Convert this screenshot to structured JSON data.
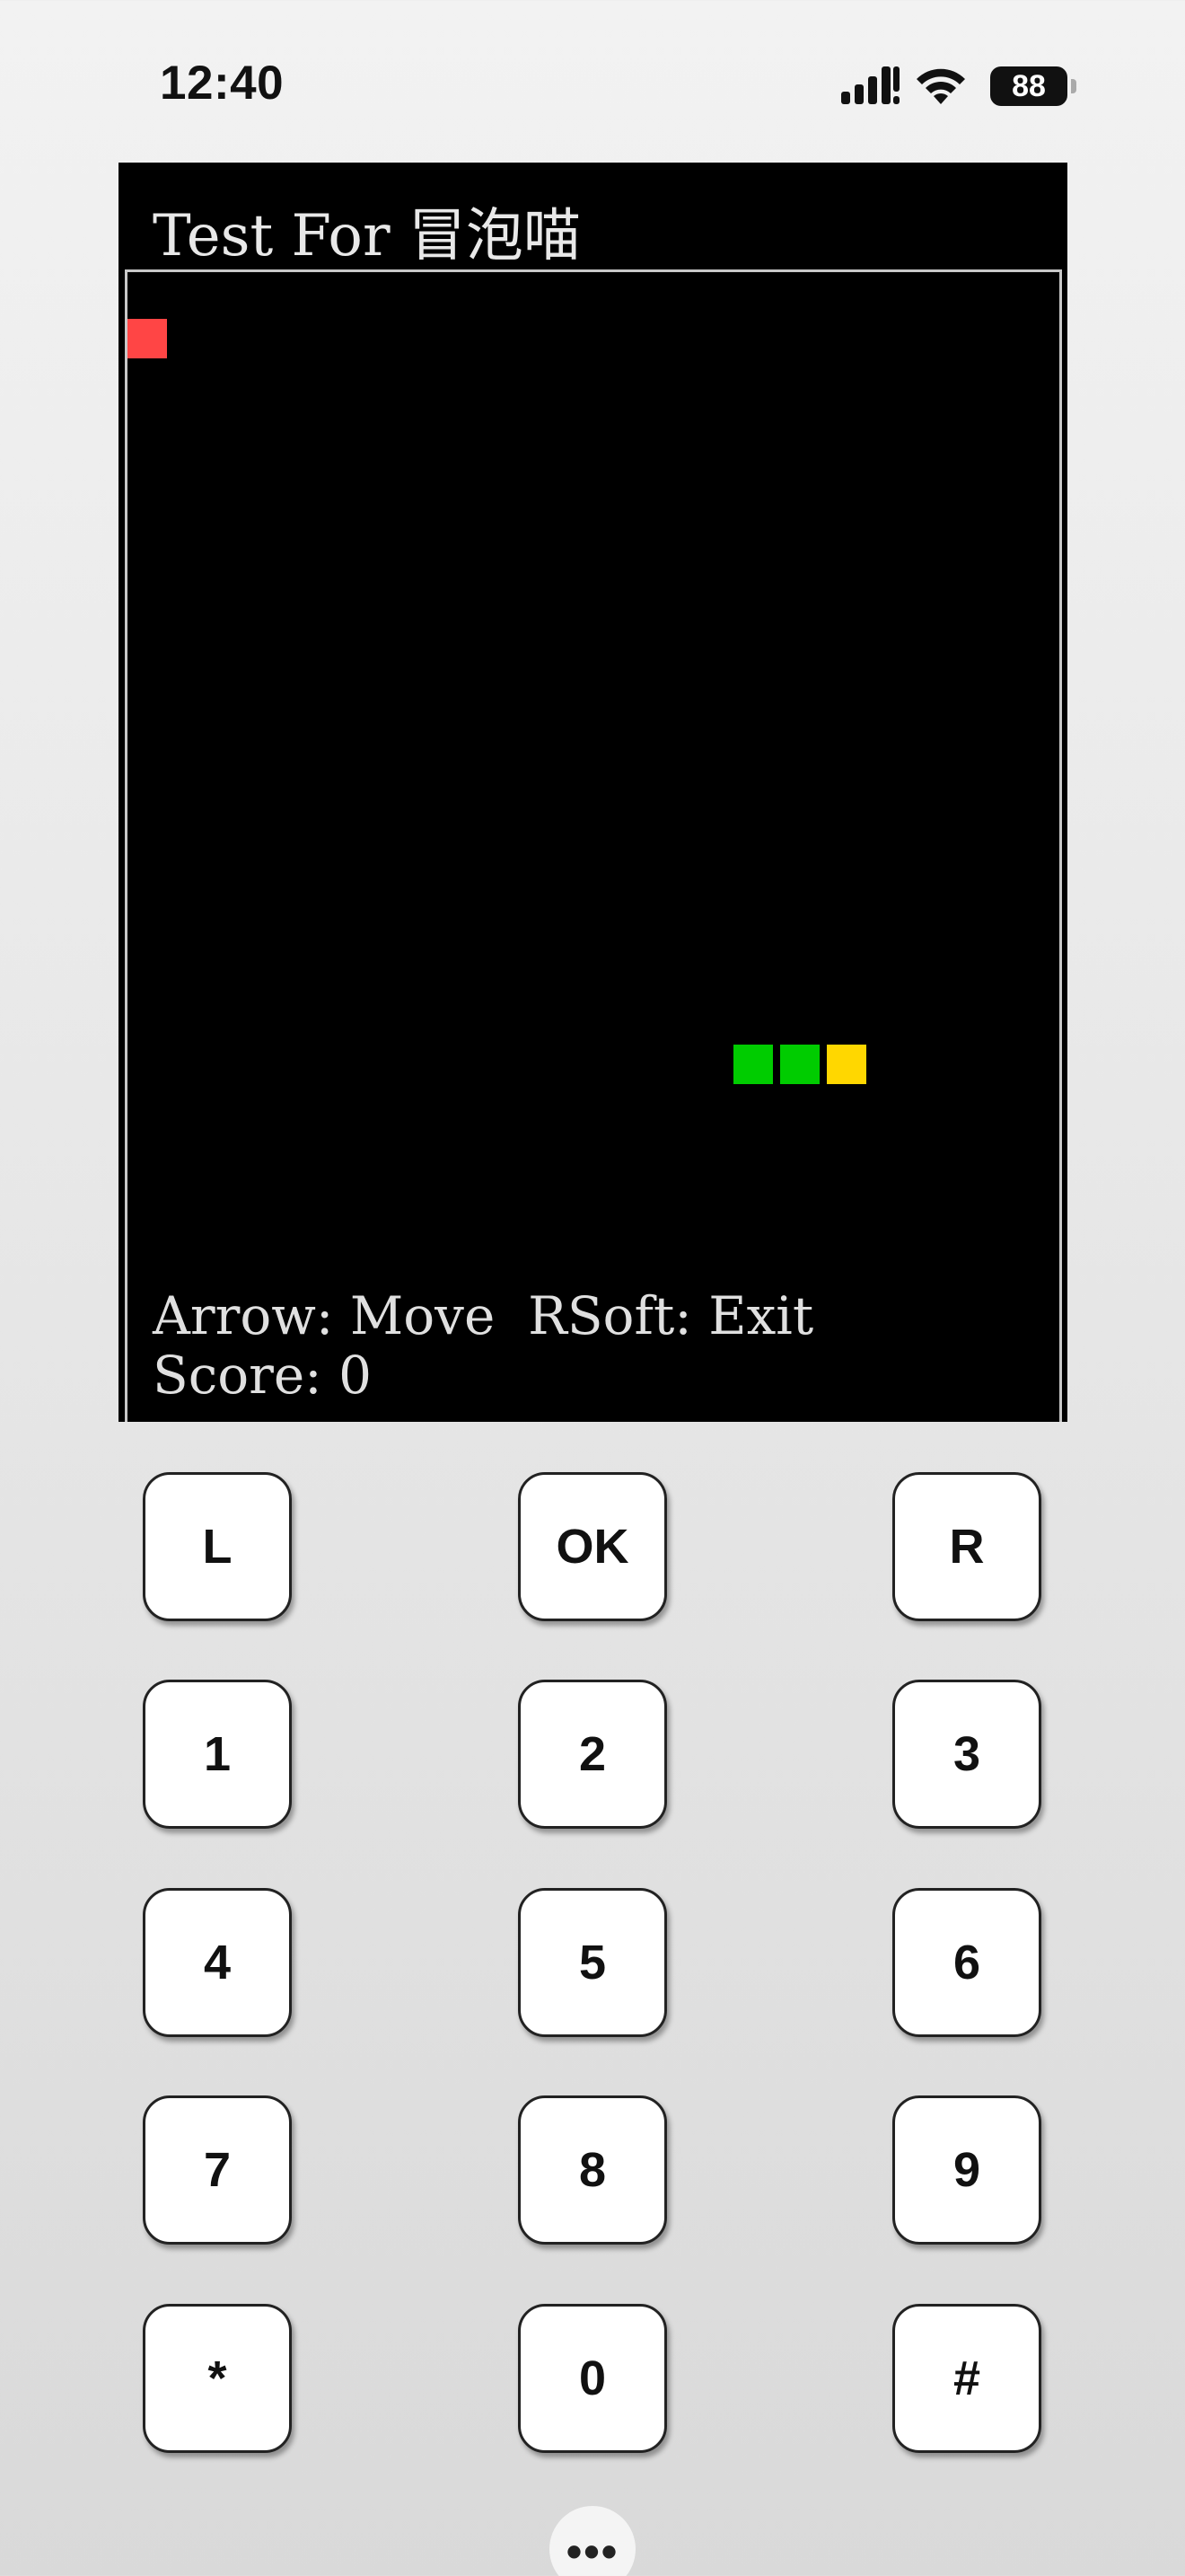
{
  "status_bar": {
    "time": "12:40",
    "battery": "88",
    "icons": [
      "cellular-signal-icon",
      "wifi-icon",
      "battery-icon"
    ]
  },
  "game": {
    "title": "Test For 冒泡喵",
    "help_text": "Arrow: Move  RSoft: Exit",
    "score_text": "Score: 0",
    "colors": {
      "background": "#000000",
      "food": "#ff4545",
      "snake_body": "#00cc00",
      "snake_head": "#ffd700"
    }
  },
  "keypad": {
    "keys": [
      "L",
      "OK",
      "R",
      "1",
      "2",
      "3",
      "4",
      "5",
      "6",
      "7",
      "8",
      "9",
      "*",
      "0",
      "#"
    ]
  },
  "more_button": {
    "label": "•••"
  }
}
